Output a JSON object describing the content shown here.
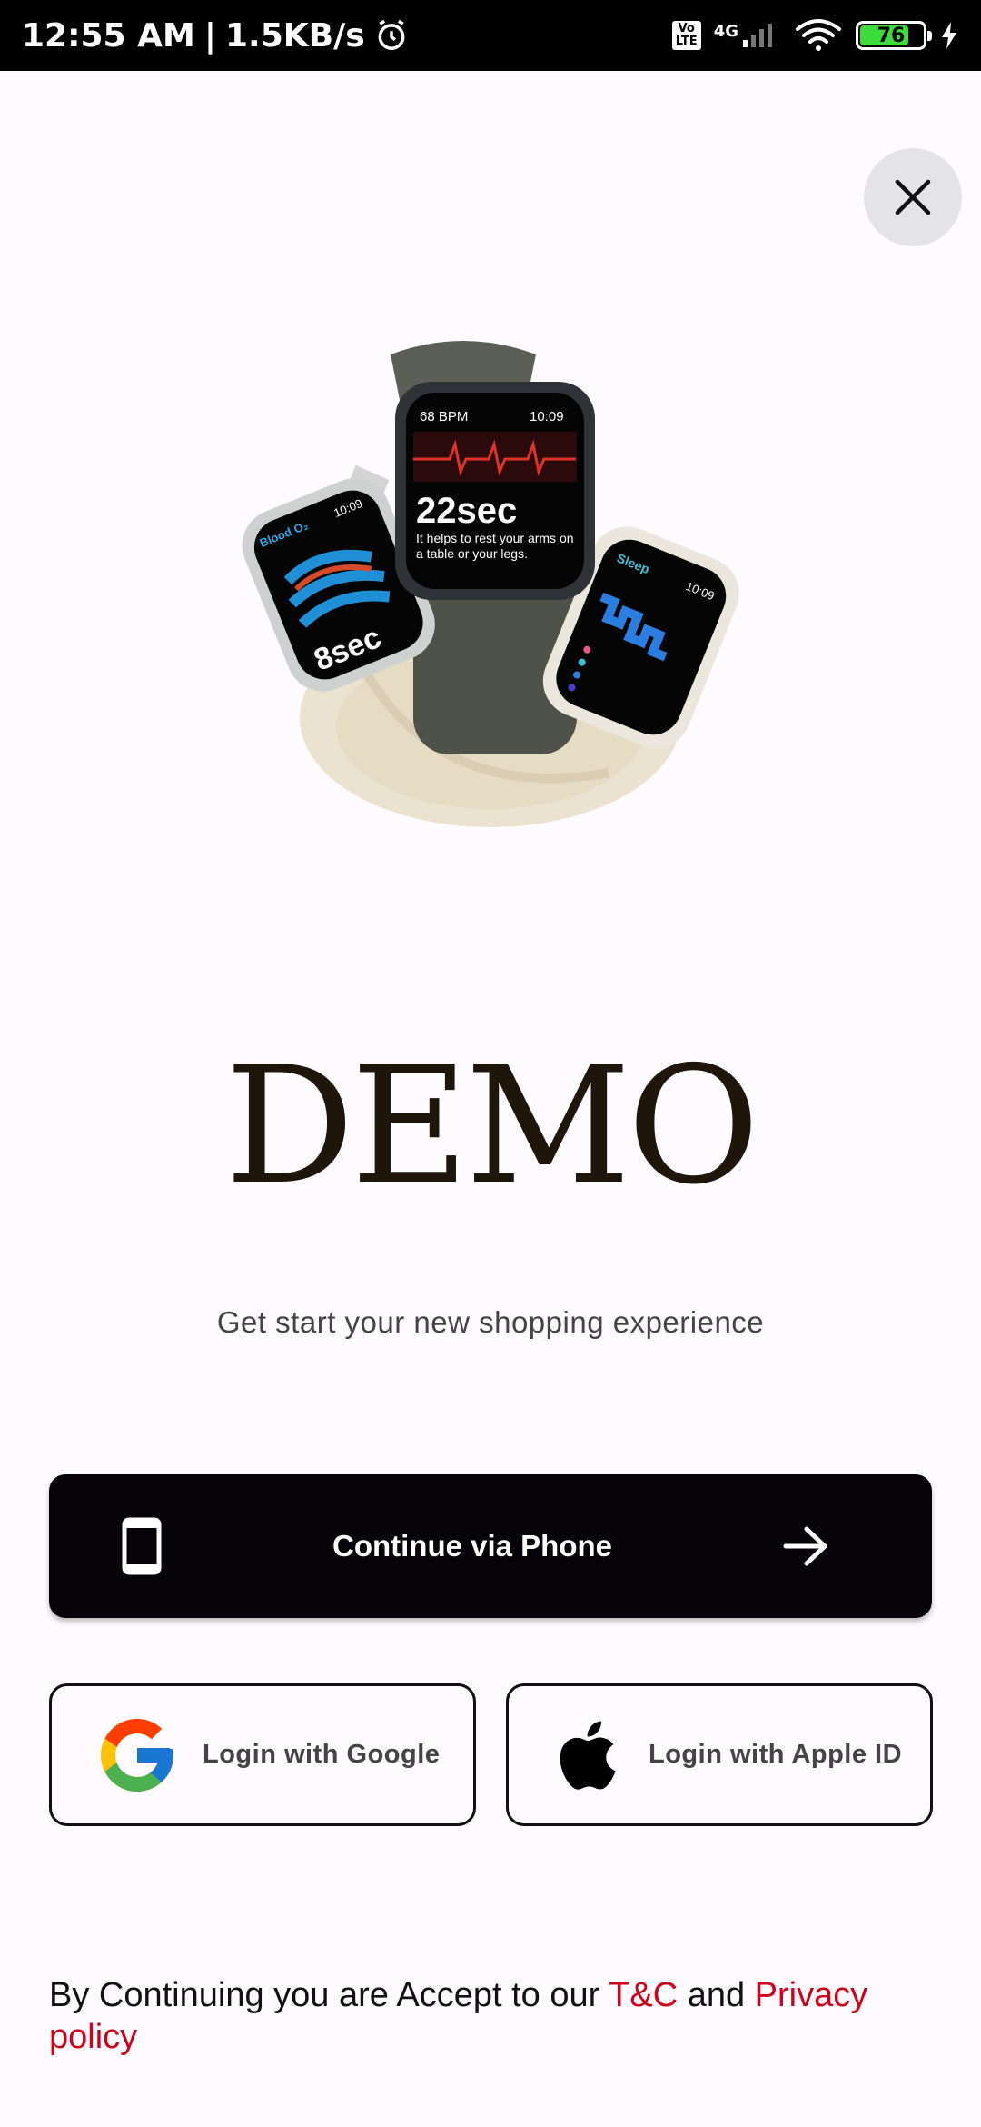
{
  "status_bar": {
    "time": "12:55 AM",
    "separator": "|",
    "speed": "1.5KB/s",
    "network": "4G",
    "volte": "Vo LTE",
    "battery_level": "76"
  },
  "brand": {
    "logo_text": "DEMO"
  },
  "tagline": "Get start your new shopping experience",
  "buttons": {
    "phone_label": "Continue via Phone",
    "google_label": "Login with Google",
    "apple_label": "Login with Apple ID"
  },
  "footer": {
    "prefix": "By Continuing you are Accept to our ",
    "tc_link": "T&C",
    "middle": " and ",
    "privacy_link": "Privacy policy"
  },
  "hero_watch": {
    "bpm": "68 BPM",
    "time_center": "10:09",
    "center_value": "22sec",
    "center_caption": "It helps to rest your arms on a table or your legs.",
    "left_label": "Blood O₂",
    "left_time": "10:09",
    "left_value": "8sec",
    "right_label": "Sleep",
    "right_time": "10:09"
  },
  "colors": {
    "accent_red": "#d0021b",
    "button_dark": "#050307",
    "battery_green": "#3ddc3d"
  }
}
